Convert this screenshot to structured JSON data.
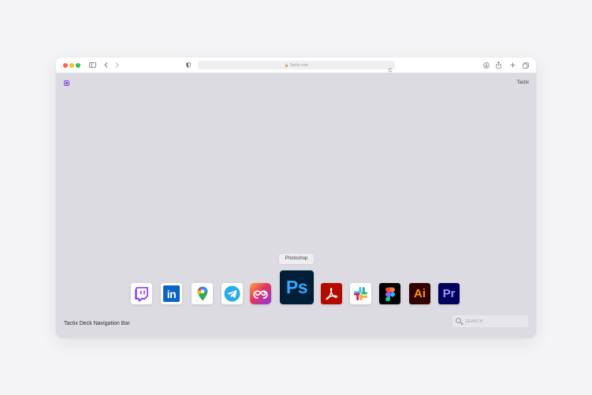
{
  "browser": {
    "url": "Tactix.com",
    "colors": {
      "close": "#ff5f57",
      "minimize": "#febc2e",
      "maximize": "#28c840"
    }
  },
  "page": {
    "brand": "Tactix",
    "footer_title": "Tactix Deck Navigation Bar",
    "search_placeholder": "SEARCH"
  },
  "dock": {
    "tooltip": "Photoshop",
    "active": "photoshop",
    "items": [
      {
        "id": "twitch",
        "icon": "twitch-icon",
        "color": "#9146ff"
      },
      {
        "id": "linkedin",
        "icon": "linkedin-icon",
        "color": "#0a66c2",
        "label": "in"
      },
      {
        "id": "google-maps",
        "icon": "google-maps-icon",
        "color": "#34a853"
      },
      {
        "id": "telegram",
        "icon": "telegram-icon",
        "color": "#2aabee"
      },
      {
        "id": "creative-cloud",
        "icon": "creative-cloud-icon",
        "color": "#da1f26"
      },
      {
        "id": "photoshop",
        "icon": "photoshop-icon",
        "color": "#31a8ff",
        "label": "Ps"
      },
      {
        "id": "acrobat",
        "icon": "acrobat-icon",
        "color": "#b30b00"
      },
      {
        "id": "slack",
        "icon": "slack-icon",
        "color": "#e01e5a"
      },
      {
        "id": "figma",
        "icon": "figma-icon",
        "color": "#a259ff"
      },
      {
        "id": "illustrator",
        "icon": "illustrator-icon",
        "color": "#ff9a00",
        "label": "Ai"
      },
      {
        "id": "premiere",
        "icon": "premiere-icon",
        "color": "#9999ff",
        "label": "Pr"
      }
    ]
  }
}
